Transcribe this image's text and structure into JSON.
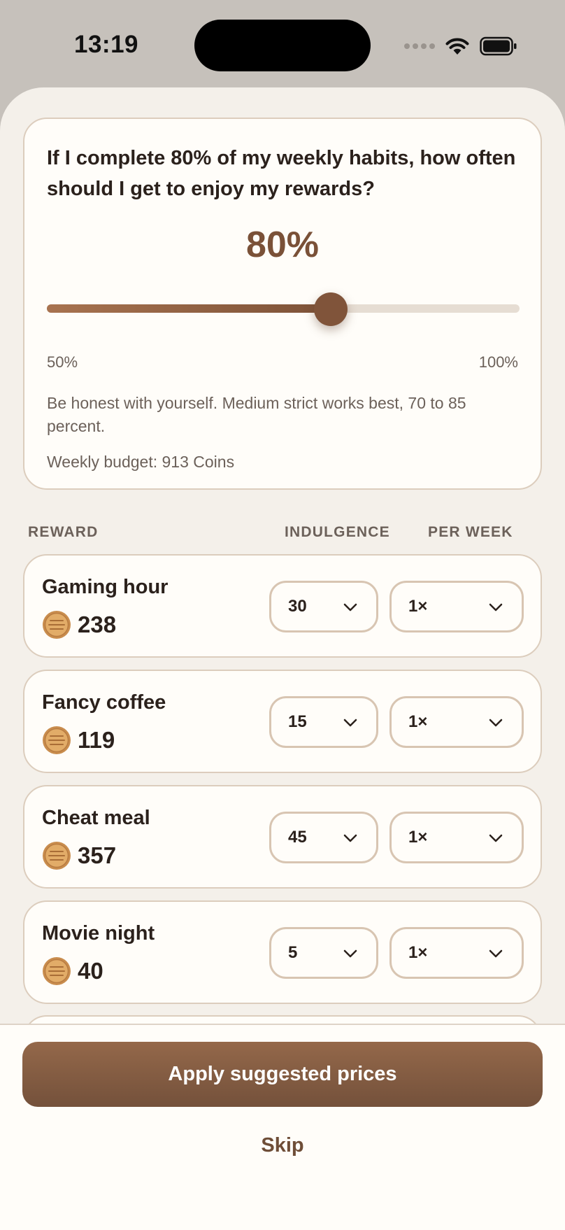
{
  "status_bar": {
    "time": "13:19"
  },
  "question": "If I complete 80% of my weekly habits, how often should I get to enjoy my rewards?",
  "completion": {
    "value_label": "80%",
    "value": 80,
    "min": 50,
    "max": 100,
    "min_label": "50%",
    "max_label": "100%"
  },
  "hint": "Be honest with yourself. Medium strict works best, 70 to 85 percent.",
  "budget": "Weekly budget: 913 Coins",
  "columns": {
    "reward": "REWARD",
    "indulgence": "INDULGENCE",
    "per_week": "PER WEEK"
  },
  "rewards": [
    {
      "name": "Gaming hour",
      "cost": "238",
      "indulgence": "30",
      "per_week": "1×"
    },
    {
      "name": "Fancy coffee",
      "cost": "119",
      "indulgence": "15",
      "per_week": "1×"
    },
    {
      "name": "Cheat meal",
      "cost": "357",
      "indulgence": "45",
      "per_week": "1×"
    },
    {
      "name": "Movie night",
      "cost": "40",
      "indulgence": "5",
      "per_week": "1×"
    }
  ],
  "footer": {
    "apply_label": "Apply suggested prices",
    "skip_label": "Skip"
  },
  "colors": {
    "accent": "#7a5138",
    "card_border": "#dccdbd",
    "sheet_bg": "#f4f0ea",
    "coin": "#d9a35f"
  }
}
